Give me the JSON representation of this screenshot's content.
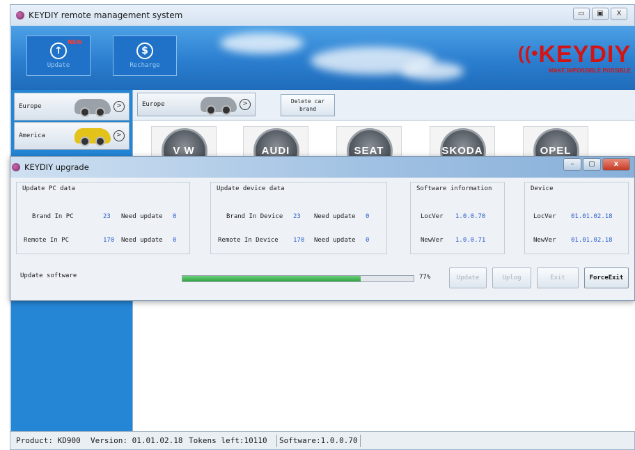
{
  "main_window": {
    "title": "KEYDIY remote management system",
    "controls": [
      "▭",
      "▣",
      "X"
    ]
  },
  "header": {
    "update_label": "Update",
    "update_badge": "NEW",
    "recharge_label": "Recharge",
    "logo_name": "KEYDIY",
    "logo_tagline": "MAKE IMPOSSIBLE POSSIBLE",
    "logo_color": "#d21414"
  },
  "sidebar": {
    "regions": [
      {
        "label": "Europe",
        "car_color": "#9aa1a8",
        "icon": "car-silver"
      },
      {
        "label": "America",
        "car_color": "#e3c21a",
        "icon": "car-yellow"
      }
    ]
  },
  "content": {
    "region_tab_label": "Europe",
    "delete_brand_label": "Delete car\nbrand",
    "brands": [
      "V W",
      "AUDI",
      "SEAT",
      "SKODA",
      "OPEL"
    ]
  },
  "dialog": {
    "title": "KEYDIY upgrade",
    "pc_data": {
      "title": "Update PC data",
      "brand_label": "Brand  In PC",
      "brand_value": "23",
      "brand_need_label": "Need update",
      "brand_need_value": "0",
      "remote_label": "Remote  In PC",
      "remote_value": "170",
      "remote_need_label": "Need update",
      "remote_need_value": "0"
    },
    "device_data": {
      "title": "Update device data",
      "brand_label": "Brand  In Device",
      "brand_value": "23",
      "brand_need_label": "Need update",
      "brand_need_value": "0",
      "remote_label": "Remote  In Device",
      "remote_value": "170",
      "remote_need_label": "Need update",
      "remote_need_value": "0"
    },
    "software_info": {
      "title": "Software information",
      "locver_label": "LocVer",
      "locver_value": "1.0.0.70",
      "newver_label": "NewVer",
      "newver_value": "1.0.0.71"
    },
    "device_info": {
      "title": "Device",
      "locver_label": "LocVer",
      "locver_value": "01.01.02.18",
      "newver_label": "NewVer",
      "newver_value": "01.01.02.18"
    },
    "update_software_label": "Update software",
    "progress_percent": 77,
    "progress_text": "77%",
    "buttons": {
      "update": "Update",
      "uplog": "Uplog",
      "exit": "Exit",
      "force_exit": "ForceExit"
    }
  },
  "statusbar": {
    "product": "Product: KD900",
    "version": "Version: 01.01.02.18",
    "tokens": "Tokens left:10110",
    "software": "Software:1.0.0.70"
  }
}
